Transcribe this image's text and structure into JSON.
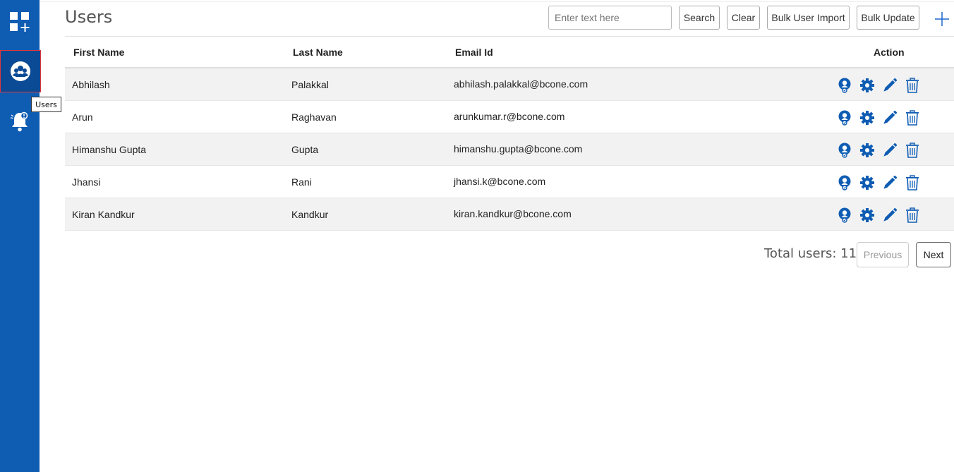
{
  "sidebar": {
    "items": [
      {
        "name": "apps",
        "icon": "grid-plus-icon"
      },
      {
        "name": "users",
        "icon": "users-icon",
        "active": true
      },
      {
        "name": "alerts",
        "icon": "bell-alert-icon"
      }
    ],
    "tooltip": "Users",
    "color": "#0f5cb3"
  },
  "header": {
    "title": "Users",
    "search_placeholder": "Enter text here",
    "search_label": "Search",
    "clear_label": "Clear",
    "bulk_import_label": "Bulk User Import",
    "bulk_update_label": "Bulk Update",
    "add_icon": "plus-icon"
  },
  "table": {
    "columns": {
      "first_name": "First Name",
      "last_name": "Last Name",
      "email": "Email Id",
      "action": "Action"
    },
    "rows": [
      {
        "first": "Abhilash",
        "last": "Palakkal",
        "email": "abhilash.palakkal@bcone.com"
      },
      {
        "first": "Arun",
        "last": "Raghavan",
        "email": "arunkumar.r@bcone.com"
      },
      {
        "first": "Himanshu Gupta",
        "last": "Gupta",
        "email": "himanshu.gupta@bcone.com"
      },
      {
        "first": "Jhansi",
        "last": "Rani",
        "email": "jhansi.k@bcone.com"
      },
      {
        "first": "Kiran Kandkur",
        "last": "Kandkur",
        "email": "kiran.kandkur@bcone.com"
      }
    ],
    "action_icons": [
      "user-badge-icon",
      "gear-icon",
      "pencil-icon",
      "trash-icon"
    ],
    "icon_color": "#0f5cb3"
  },
  "footer": {
    "total_text": "Total users: 11",
    "previous_label": "Previous",
    "next_label": "Next"
  }
}
